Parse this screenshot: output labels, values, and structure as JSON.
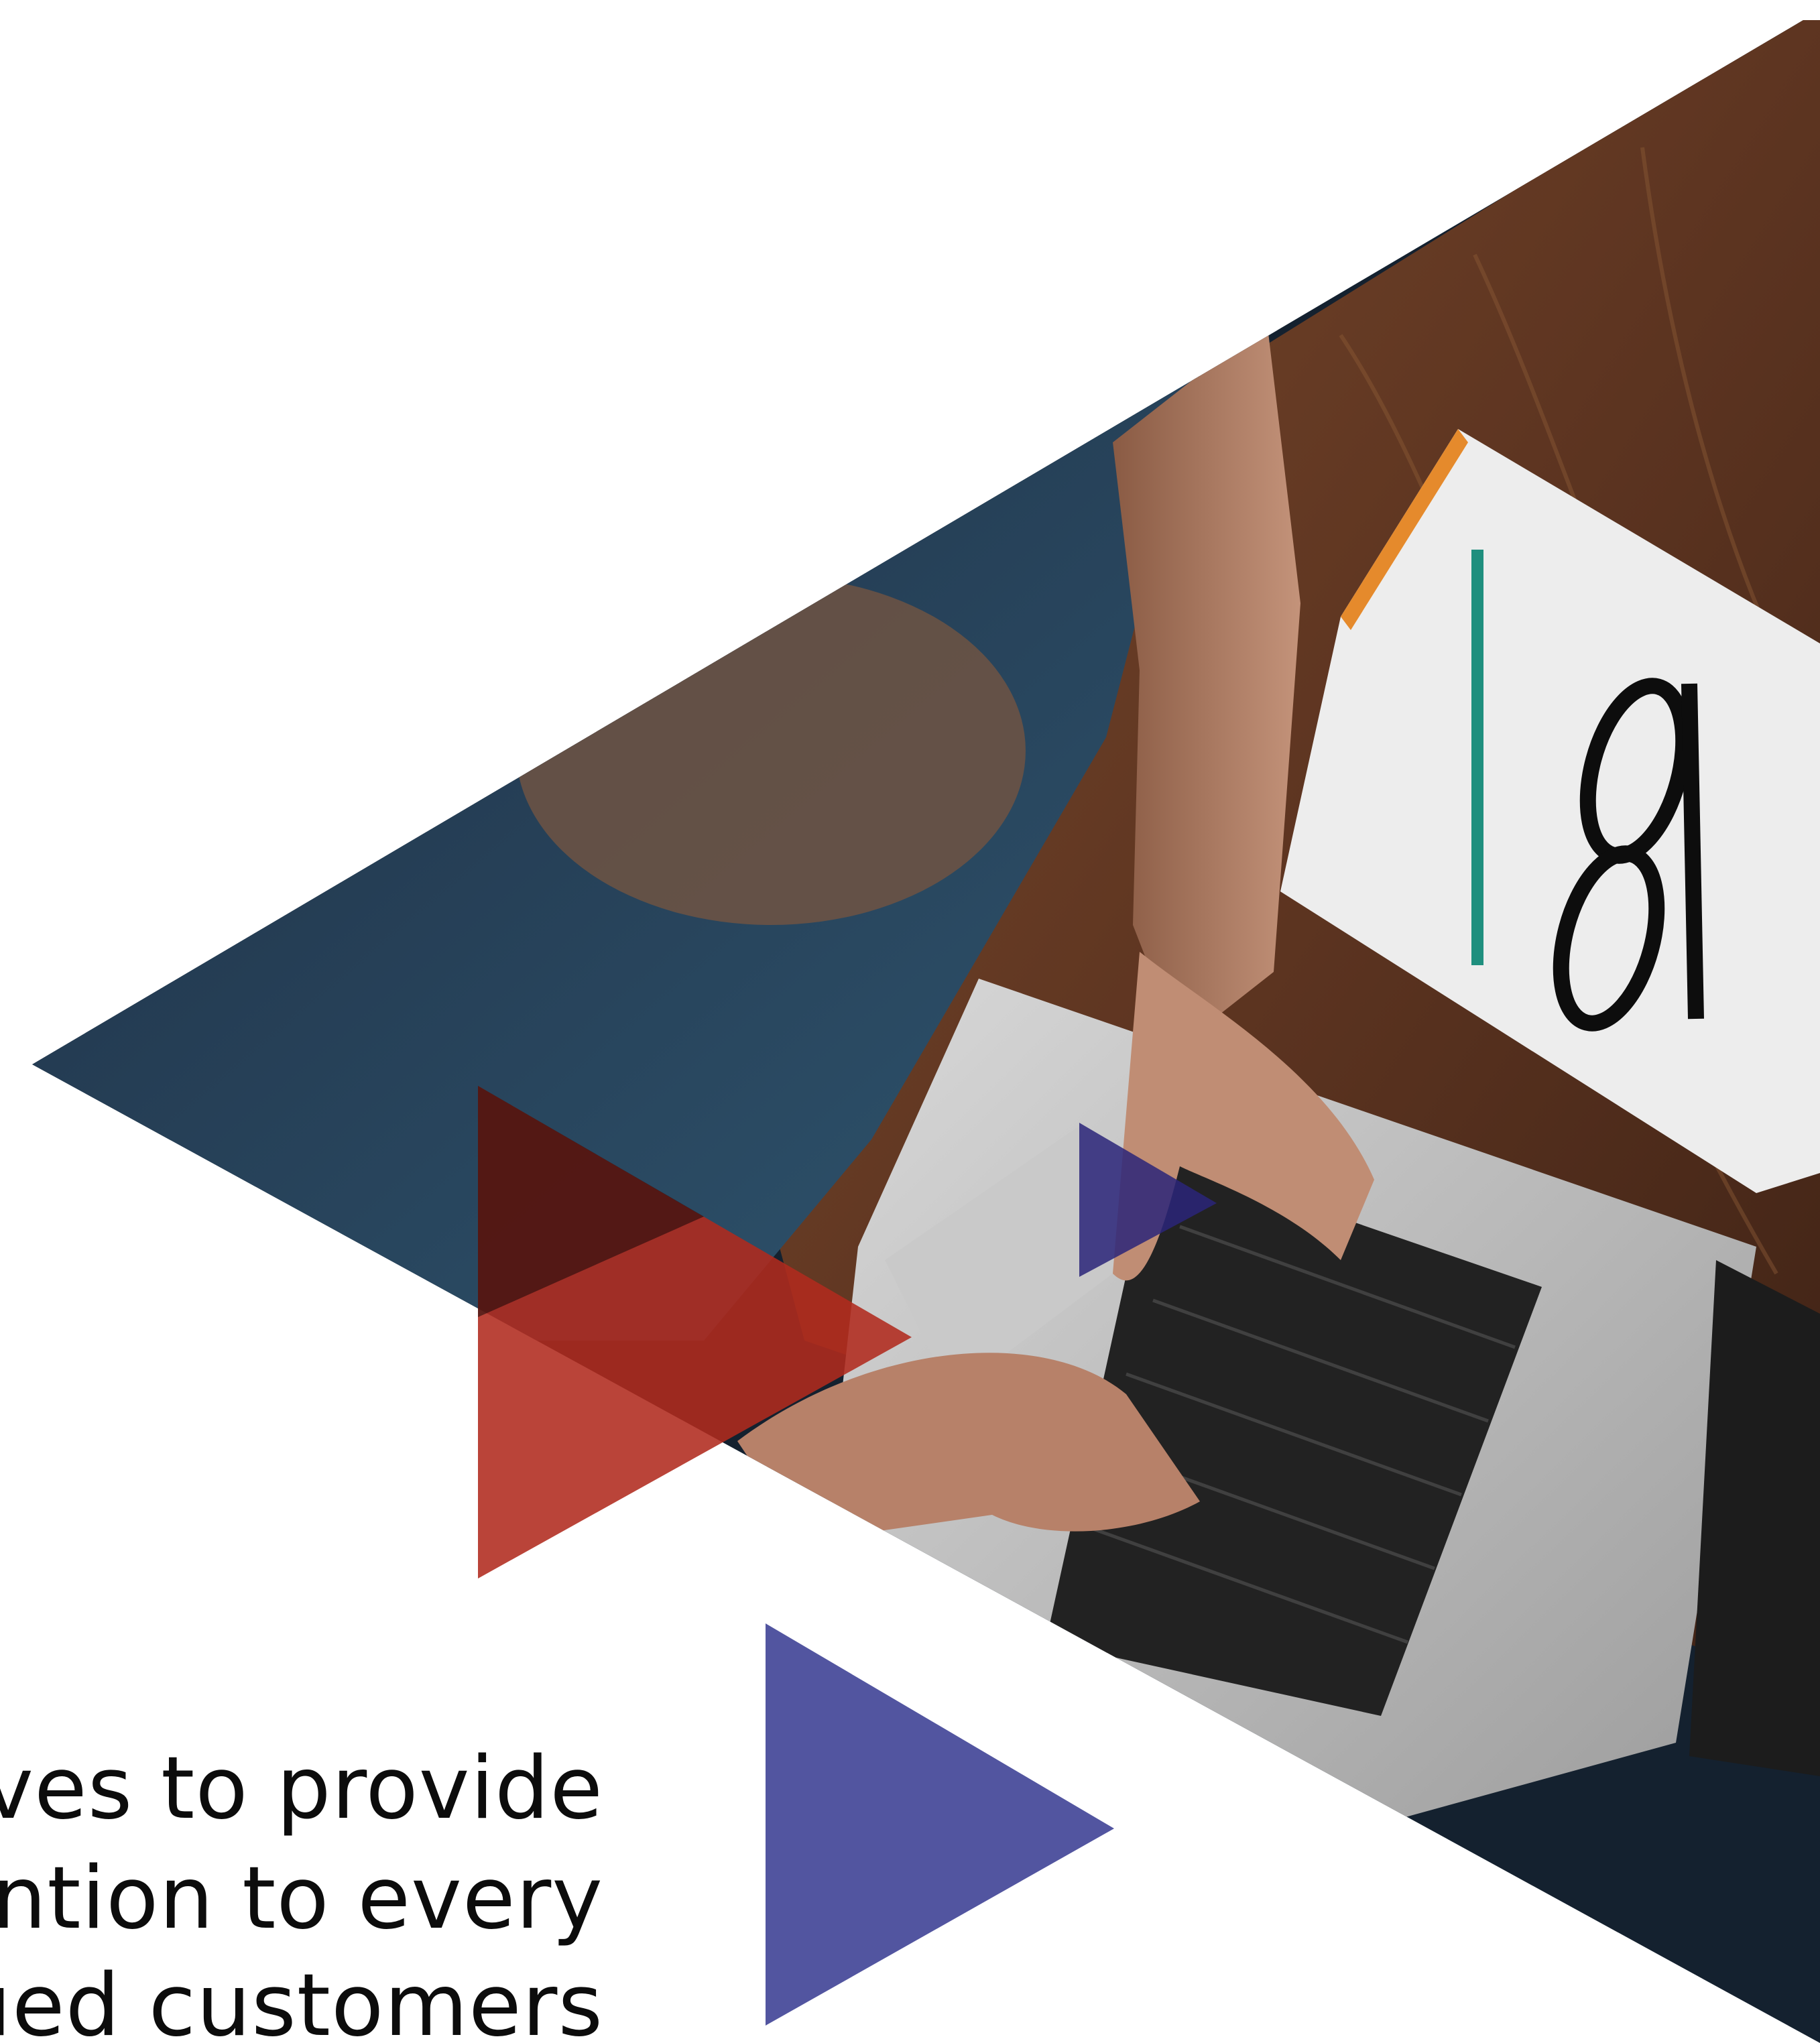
{
  "colors": {
    "background": "#ffffff",
    "photo_dark": "#14212f",
    "wood": "#5e3521",
    "red_accent": "#b12a1e",
    "blue_accent": "#5255a0",
    "text": "#0c0c0c"
  },
  "illustration": {
    "subject_icon": "laptop-desk-photo-icon",
    "shapes": [
      "large-photo-triangle",
      "red-play-triangle",
      "blue-play-triangle",
      "small-indigo-triangle"
    ]
  },
  "copy": {
    "lines": [
      "trives to provide",
      "tention  to  every",
      "alued customers"
    ]
  }
}
